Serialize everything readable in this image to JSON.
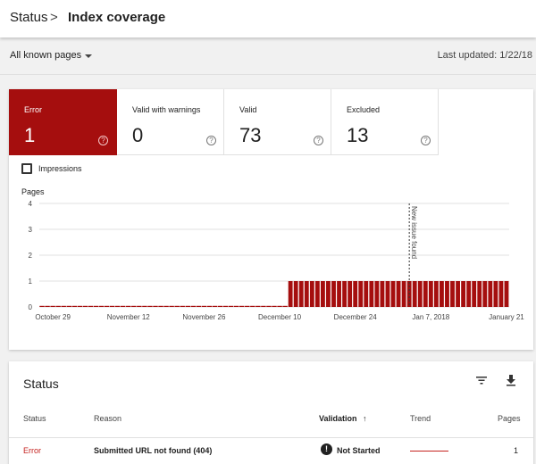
{
  "breadcrumb": {
    "parent": "Status",
    "separator": ">",
    "current": "Index coverage"
  },
  "filter": {
    "selected": "All known pages",
    "last_updated": "Last updated: 1/22/18"
  },
  "tiles": [
    {
      "label": "Error",
      "value": "1"
    },
    {
      "label": "Valid with warnings",
      "value": "0"
    },
    {
      "label": "Valid",
      "value": "73"
    },
    {
      "label": "Excluded",
      "value": "13"
    }
  ],
  "impressions_label": "Impressions",
  "impressions_checked": false,
  "chart_data": {
    "type": "bar",
    "ylabel": "Pages",
    "ylim": [
      0,
      4
    ],
    "yticks": [
      "0",
      "1",
      "2",
      "3",
      "4"
    ],
    "xticks": [
      "October 29",
      "November 12",
      "November 26",
      "December 10",
      "December 24",
      "Jan 7, 2018",
      "January 21"
    ],
    "series": [
      {
        "name": "Error",
        "color": "#a50e0e",
        "days": 87,
        "values": [
          0,
          0,
          0,
          0,
          0,
          0,
          0,
          0,
          0,
          0,
          0,
          0,
          0,
          0,
          0,
          0,
          0,
          0,
          0,
          0,
          0,
          0,
          0,
          0,
          0,
          0,
          0,
          0,
          0,
          0,
          0,
          0,
          0,
          0,
          0,
          0,
          0,
          0,
          0,
          0,
          0,
          0,
          0,
          0,
          0,
          0,
          1,
          1,
          1,
          1,
          1,
          1,
          1,
          1,
          1,
          1,
          1,
          1,
          1,
          1,
          1,
          1,
          1,
          1,
          1,
          1,
          1,
          1,
          1,
          1,
          1,
          1,
          1,
          1,
          1,
          1,
          1,
          1,
          1,
          1,
          1,
          1,
          1,
          1,
          1,
          1,
          1
        ]
      }
    ],
    "annotation": {
      "label": "New issue found",
      "day_index": 68
    },
    "grid": true
  },
  "table": {
    "title": "Status",
    "columns": {
      "status": "Status",
      "reason": "Reason",
      "validation": "Validation",
      "trend": "Trend",
      "pages": "Pages"
    },
    "sort_arrow": "↑",
    "rows": [
      {
        "status": "Error",
        "reason": "Submitted URL not found (404)",
        "validation": "Not Started",
        "validation_icon": "!",
        "pages": "1"
      }
    ]
  },
  "colors": {
    "error": "#a50e0e",
    "error_text": "#c5221f"
  }
}
